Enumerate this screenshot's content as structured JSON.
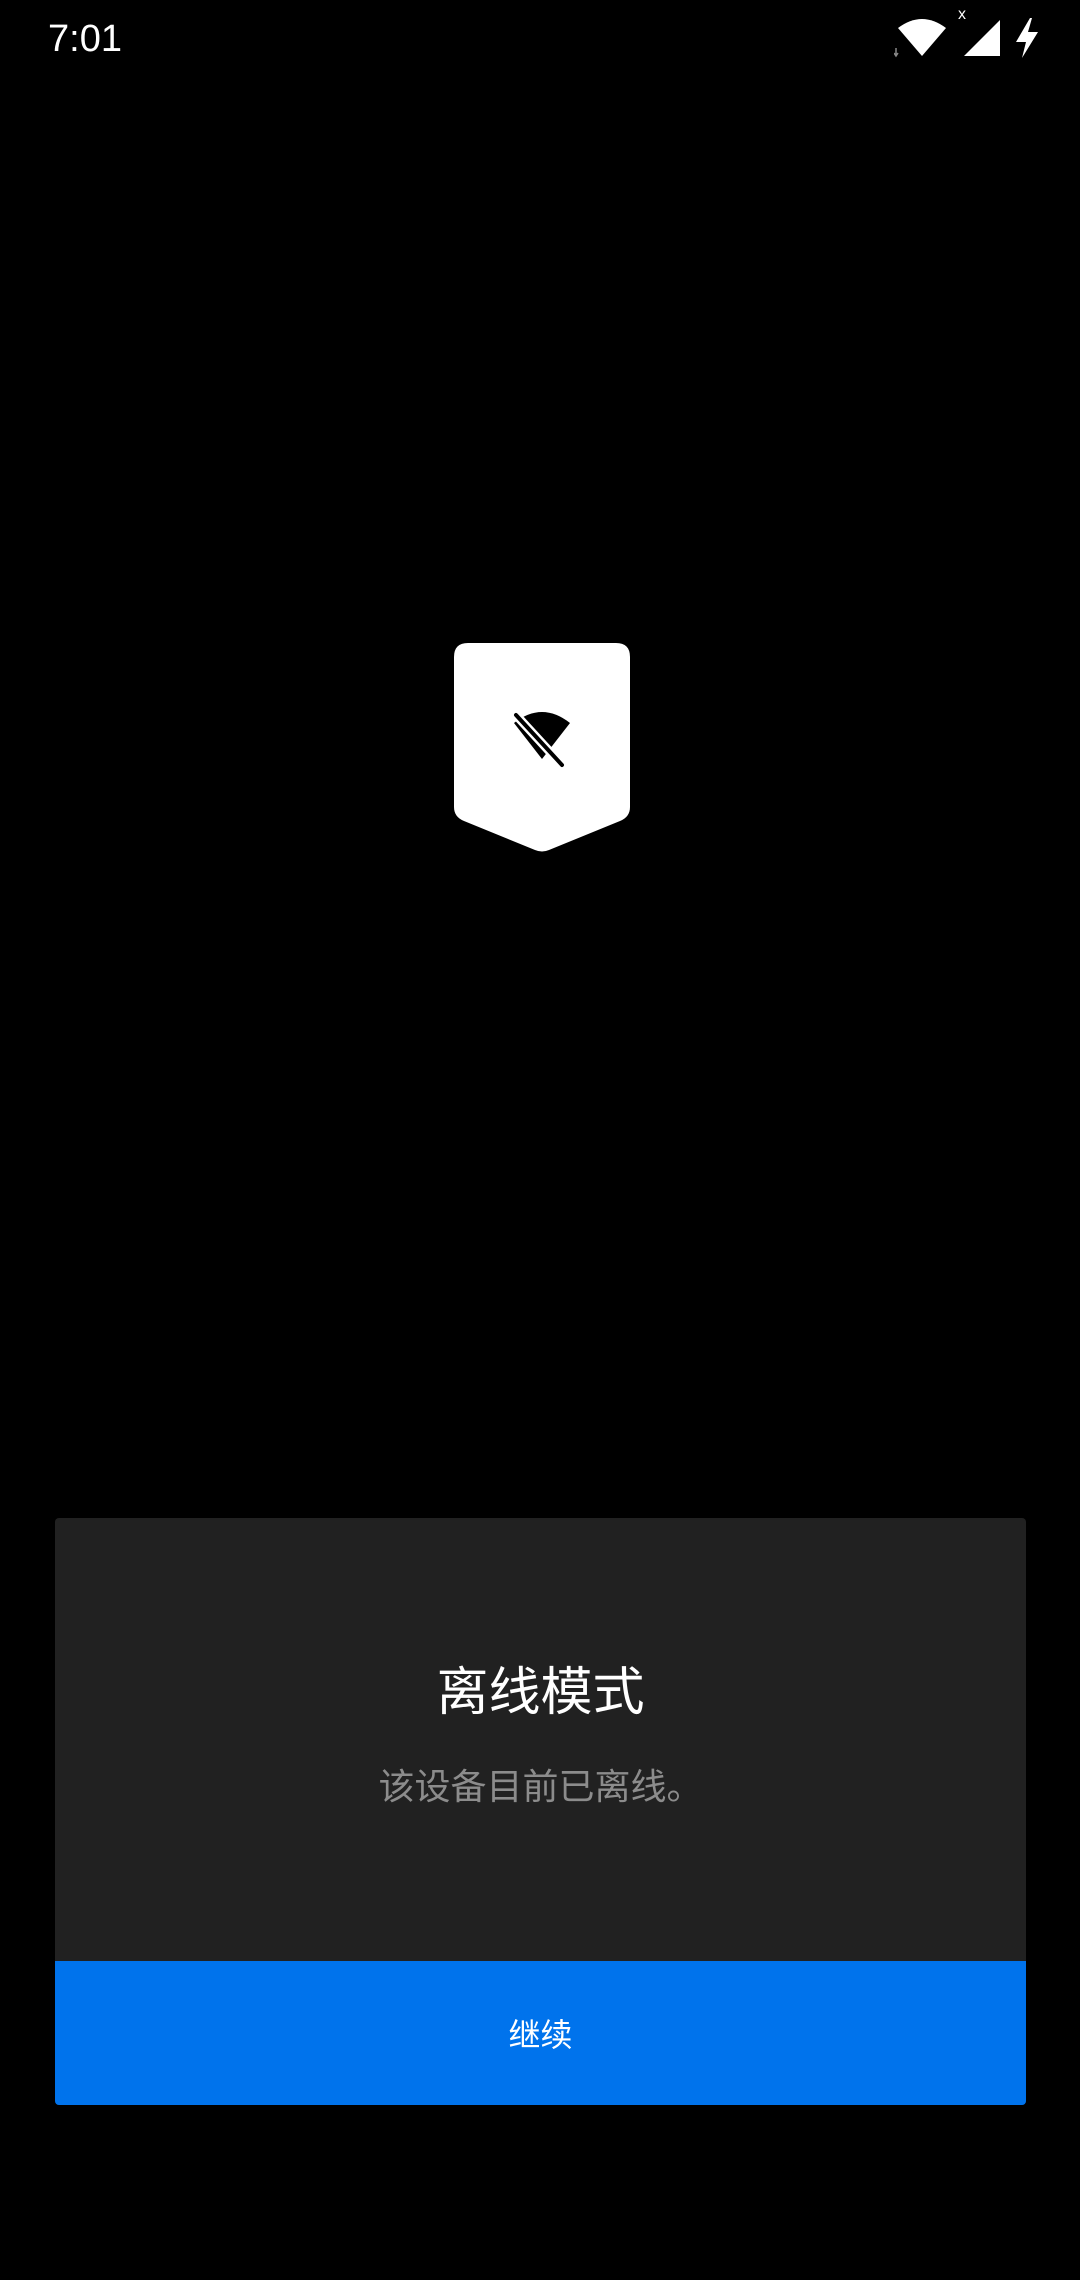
{
  "status_bar": {
    "time": "7:01",
    "icons": [
      "wifi-icon",
      "signal-icon",
      "charging-icon"
    ],
    "signal_badge": "x"
  },
  "offline_badge": {
    "icon": "wifi-off-icon",
    "colors": {
      "badge": "#ffffff",
      "glyph": "#000000"
    }
  },
  "dialog": {
    "title": "离线模式",
    "message": "该设备目前已离线。",
    "button_label": "继续",
    "colors": {
      "background": "#212121",
      "button": "#0073ec",
      "message_text": "#8c8c8c"
    }
  }
}
